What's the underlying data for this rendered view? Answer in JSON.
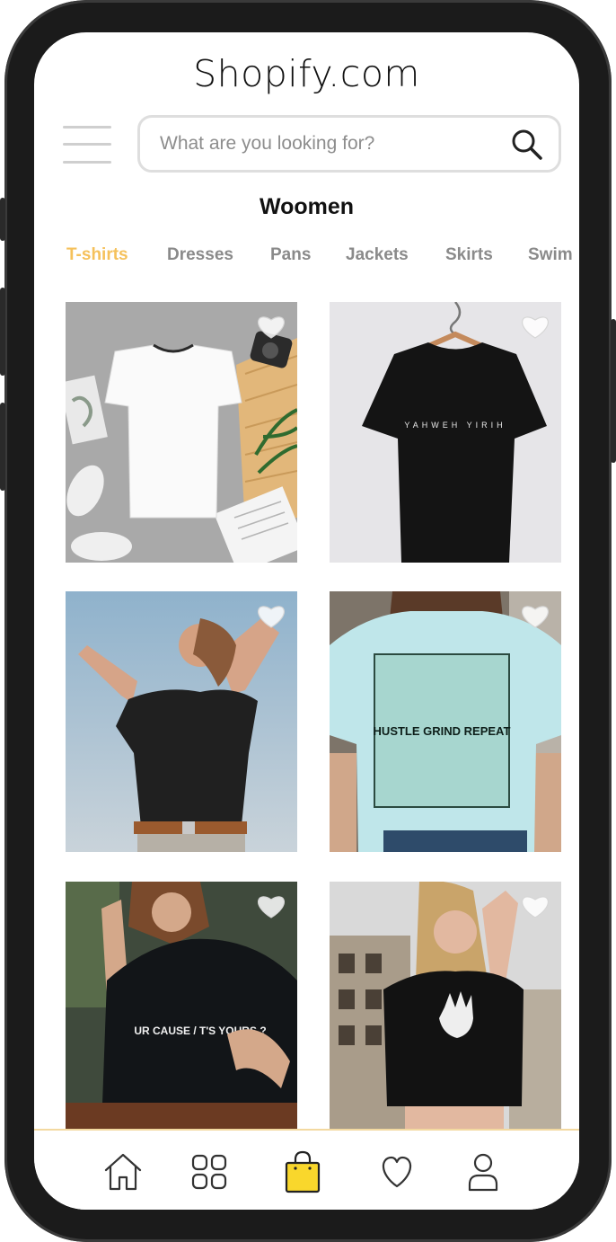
{
  "app": {
    "brand": "Shopify.com"
  },
  "search": {
    "placeholder": "What are you looking for?",
    "value": ""
  },
  "section": {
    "title": "Woomen"
  },
  "categories": [
    {
      "label": "T-shirts",
      "active": true
    },
    {
      "label": "Dresses",
      "active": false
    },
    {
      "label": "Pans",
      "active": false
    },
    {
      "label": "Jackets",
      "active": false
    },
    {
      "label": "Skirts",
      "active": false
    },
    {
      "label": "Swim",
      "active": false
    }
  ],
  "products": [
    {
      "image": "white-v-neck-tshirt-flatlay",
      "favorite": false
    },
    {
      "image": "black-tshirt-on-hanger",
      "print_text": "YAHWEH YIRIH",
      "favorite": false
    },
    {
      "image": "woman-black-tshirt-sky",
      "favorite": false
    },
    {
      "image": "light-blue-tshirt-back-print",
      "print_text": "HUSTLE GRIND REPEAT",
      "favorite": false
    },
    {
      "image": "woman-black-graphic-tshirt",
      "print_text": "UR CAUSE / T'S YOURS ?",
      "favorite": false
    },
    {
      "image": "woman-black-crop-tshirt-skeleton-hand",
      "favorite": false
    }
  ],
  "bottom_nav": [
    {
      "icon": "home-icon",
      "active": false
    },
    {
      "icon": "grid-icon",
      "active": false
    },
    {
      "icon": "shopping-bag-icon",
      "active": true
    },
    {
      "icon": "heart-icon",
      "active": false
    },
    {
      "icon": "user-icon",
      "active": false
    }
  ],
  "colors": {
    "accent": "#f5c15b",
    "bag_fill": "#f9d72c",
    "tab_inactive": "#8a8a8a",
    "text": "#111111"
  }
}
